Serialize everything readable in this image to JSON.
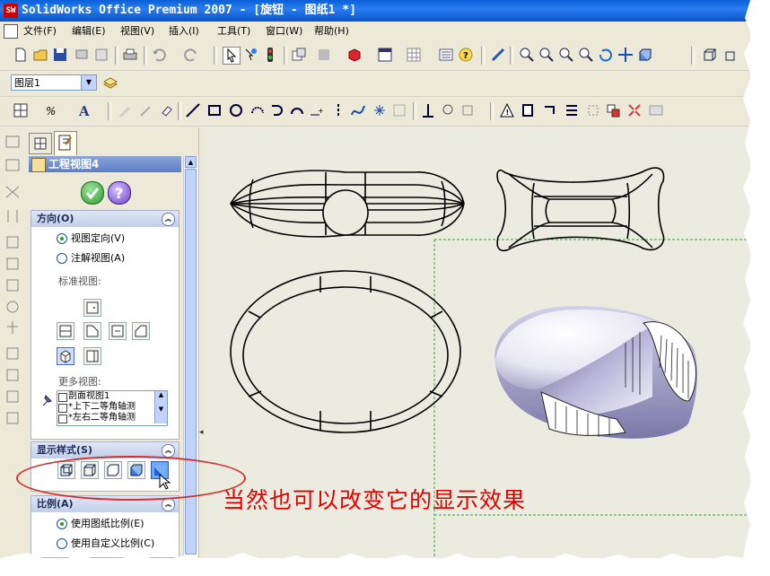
{
  "window": {
    "title": "SolidWorks Office Premium 2007 - [旋钮 - 图纸1 *]",
    "app_icon_text": "SW"
  },
  "menu": {
    "items": [
      "文件(F)",
      "编辑(E)",
      "视图(V)",
      "插入(I)",
      "工具(T)",
      "窗口(W)",
      "帮助(H)"
    ]
  },
  "layer": {
    "value": "图层1"
  },
  "property_panel": {
    "title": "工程视图4",
    "orientation": {
      "header": "方向(O)",
      "option_view_orientation": "视图定向(V)",
      "option_annotation_view": "注解视图(A)",
      "standard_views_label": "标准视图:",
      "more_views_label": "更多视图:",
      "more_views": [
        "剖面视图1",
        "*上下二等角轴测",
        "*左右二等角轴测"
      ]
    },
    "display_style": {
      "header": "显示样式(S)"
    },
    "scale": {
      "header": "比例(A)",
      "option_sheet_scale": "使用图纸比例(E)",
      "option_custom_scale": "使用自定义比例(C)"
    }
  },
  "annotation": {
    "text": "当然也可以改变它的显示效果",
    "color": "#e00000"
  },
  "colors": {
    "title_bar": "#0a5fd8",
    "chrome": "#ece9d8",
    "canvas": "#ecebe0",
    "highlight_ellipse": "#d43030",
    "bounding_box": "#3aa33a"
  }
}
